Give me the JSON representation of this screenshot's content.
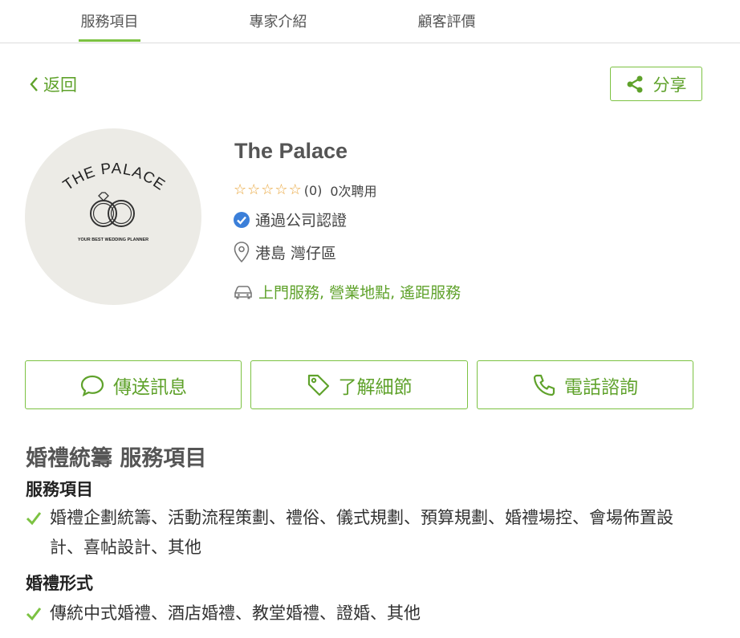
{
  "tabs": [
    {
      "label": "服務項目",
      "active": true
    },
    {
      "label": "專家介紹",
      "active": false
    },
    {
      "label": "顧客評價",
      "active": false
    }
  ],
  "nav": {
    "back_label": "返回",
    "share_label": "分享"
  },
  "logo": {
    "arc_text": "THE PALACE",
    "tagline": "YOUR BEST WEDDING PLANNER"
  },
  "profile": {
    "name": "The Palace",
    "rating_count": "(0)",
    "hires": "0次聘用",
    "verified": "通過公司認證",
    "location": "港島 灣仔區",
    "service_modes": "上門服務, 營業地點, 遙距服務",
    "star_count": 5
  },
  "actions": {
    "message": "傳送訊息",
    "details": "了解細節",
    "phone": "電話諮詢"
  },
  "services": {
    "title": "婚禮統籌 服務項目",
    "sections": [
      {
        "heading": "服務項目",
        "items": "婚禮企劃統籌、活動流程策劃、禮俗、儀式規劃、預算規劃、婚禮場控、會場佈置設計、喜帖設計、其他"
      },
      {
        "heading": "婚禮形式",
        "items": "傳統中式婚禮、酒店婚禮、教堂婚禮、證婚、其他"
      }
    ]
  },
  "colors": {
    "accent": "#7cc242",
    "accent_text": "#5fa22b",
    "star": "#e9a53a",
    "verified": "#3b7fd9"
  }
}
